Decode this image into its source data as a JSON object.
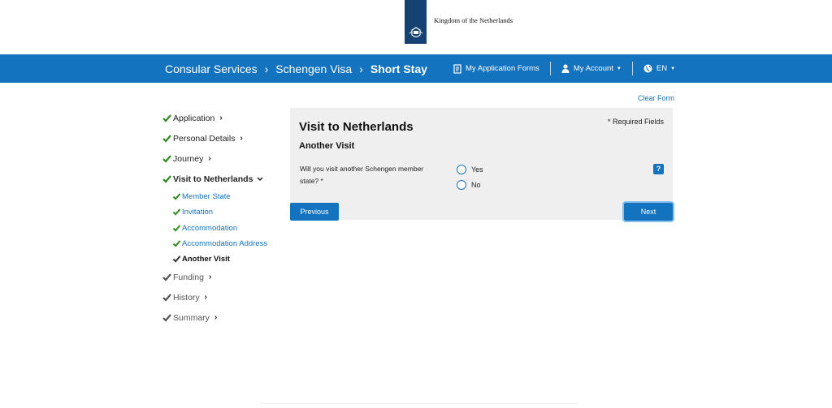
{
  "brand": {
    "name": "Kingdom of the Netherlands"
  },
  "nav": {
    "breadcrumbs": [
      "Consular Services",
      "Schengen Visa",
      "Short Stay"
    ],
    "my_forms": "My Application Forms",
    "my_account": "My Account",
    "language": "EN"
  },
  "sidebar": {
    "steps": [
      {
        "label": "Application",
        "state": "done"
      },
      {
        "label": "Personal Details",
        "state": "done"
      },
      {
        "label": "Journey",
        "state": "done"
      },
      {
        "label": "Visit to Netherlands",
        "state": "open"
      },
      {
        "label": "Funding",
        "state": "pending"
      },
      {
        "label": "History",
        "state": "pending"
      },
      {
        "label": "Summary",
        "state": "pending"
      }
    ],
    "substeps": [
      {
        "label": "Member State",
        "state": "done"
      },
      {
        "label": "Invitation",
        "state": "done"
      },
      {
        "label": "Accommodation",
        "state": "done"
      },
      {
        "label": "Accommodation Address",
        "state": "done"
      },
      {
        "label": "Another Visit",
        "state": "active"
      }
    ]
  },
  "form": {
    "clear_label": "Clear Form",
    "title": "Visit to Netherlands",
    "required_note": "* Required Fields",
    "section": "Another Visit",
    "question": "Will you visit another Schengen member state? *",
    "options": [
      "Yes",
      "No"
    ],
    "help": "?",
    "previous_label": "Previous",
    "next_label": "Next"
  },
  "colors": {
    "primary": "#1473bf",
    "check_green": "#2e8b1e",
    "ribbon": "#154273",
    "panel": "#efefef"
  }
}
